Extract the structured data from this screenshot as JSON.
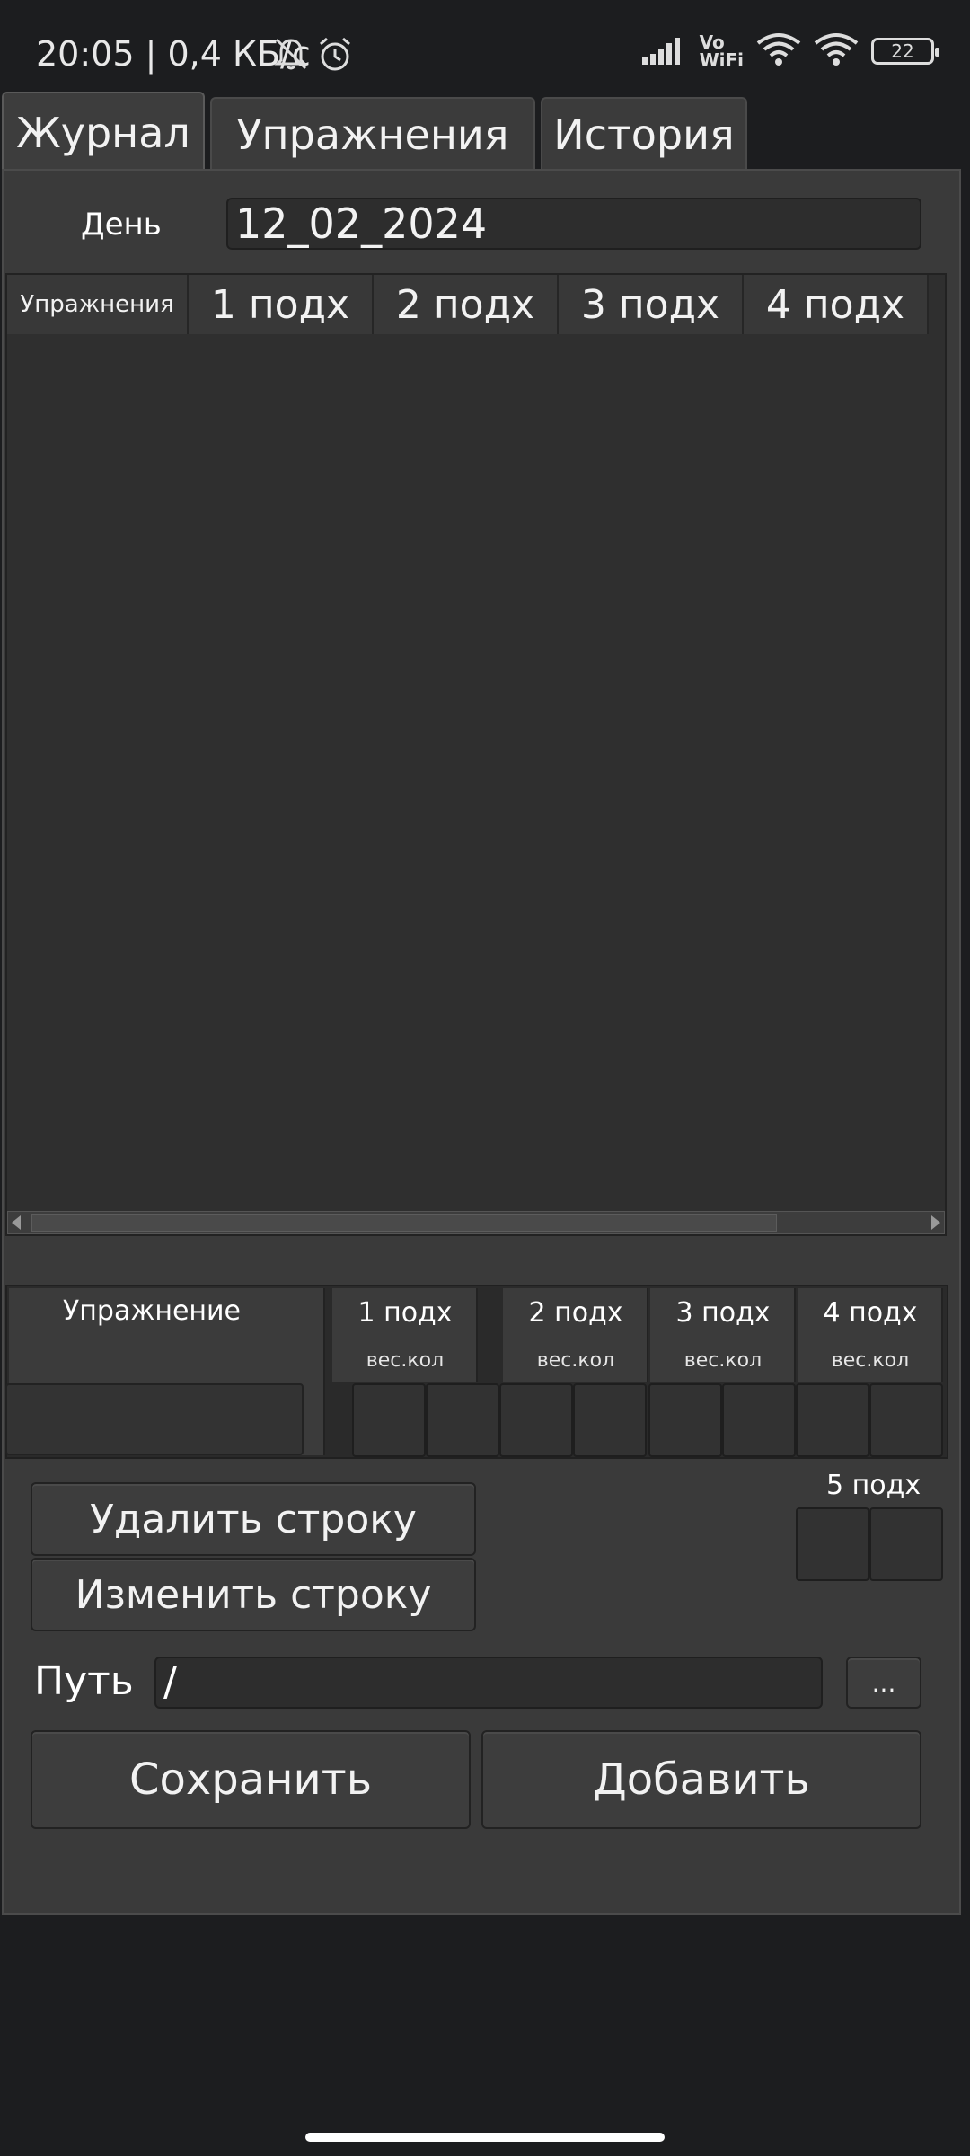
{
  "status_bar": {
    "time": "20:05 | 0,4 КБ/с",
    "volte": "Vo\nWiFi",
    "battery": "22"
  },
  "tabs": [
    {
      "label": "Журнал",
      "active": true
    },
    {
      "label": "Упражнения",
      "active": false
    },
    {
      "label": "История",
      "active": false
    }
  ],
  "journal": {
    "day_label": "День",
    "day_value": "12_02_2024",
    "grid": {
      "columns": [
        "Упражнения",
        "1 подх",
        "2 подх",
        "3 подх",
        "4 подх"
      ],
      "rows": []
    },
    "entry": {
      "exercise_label": "Упражнение",
      "sets": [
        {
          "label": "1 подх",
          "sub": "вес.кол"
        },
        {
          "label": "2 подх",
          "sub": "вес.кол"
        },
        {
          "label": "3 подх",
          "sub": "вес.кол"
        },
        {
          "label": "4 подх",
          "sub": "вес.кол"
        }
      ],
      "fifth_set_label": "5 подх"
    },
    "buttons": {
      "delete_row": "Удалить строку",
      "edit_row": "Изменить строку",
      "browse": "...",
      "save": "Сохранить",
      "add": "Добавить"
    },
    "path_label": "Путь",
    "path_value": "/"
  },
  "colors": {
    "background": "#1c1d1f",
    "panel": "#3a3a3a",
    "input": "#2d2d2d"
  }
}
